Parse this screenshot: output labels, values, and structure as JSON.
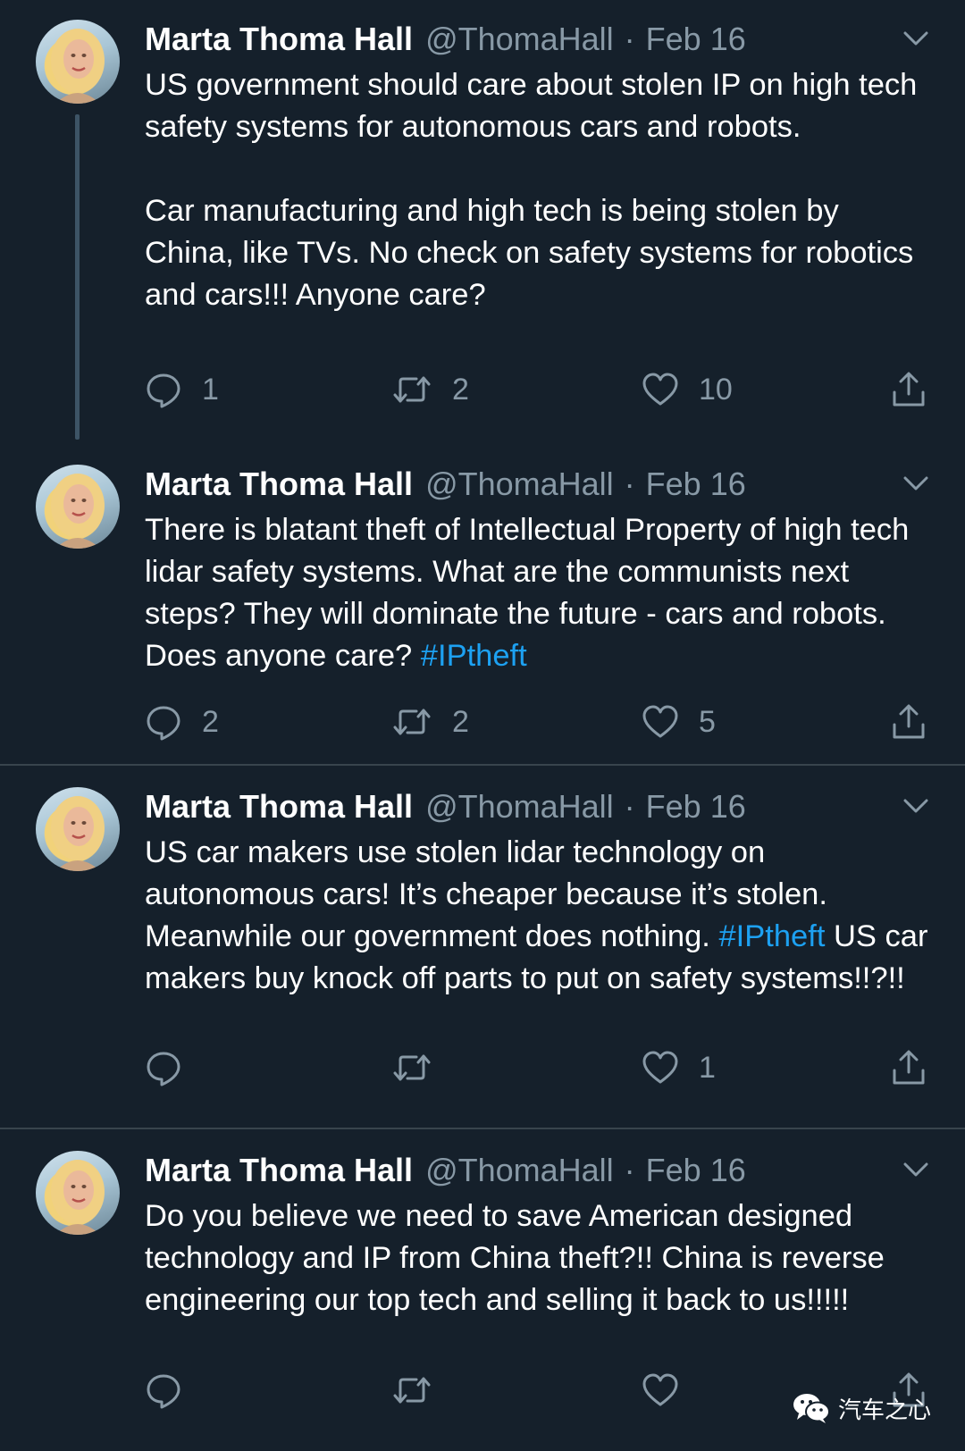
{
  "author": {
    "name": "Marta Thoma Hall",
    "handle": "@ThomaHall",
    "separator": "·"
  },
  "tweets": [
    {
      "date": "Feb 16",
      "paragraph1": "US government should care about stolen IP on high tech safety systems for autonomous cars and robots.",
      "paragraph2": "Car manufacturing and high tech is being stolen by China, like TVs. No check on safety systems for robotics and cars!!! Anyone care?",
      "replies": "1",
      "retweets": "2",
      "likes": "10"
    },
    {
      "date": "Feb 16",
      "text_before": "There is blatant theft of Intellectual Property of high tech lidar safety systems. What are the communists next steps? They will dominate the future - cars and robots. Does anyone care? ",
      "hashtag": "#IPtheft",
      "replies": "2",
      "retweets": "2",
      "likes": "5"
    },
    {
      "date": "Feb 16",
      "text_before": "US car makers use stolen lidar technology on autonomous cars! It’s cheaper because it’s stolen. Meanwhile our government does nothing. ",
      "hashtag": "#IPtheft",
      "text_after": " US car makers buy knock off parts to put on safety systems!!?!!",
      "replies": "",
      "retweets": "",
      "likes": "1"
    },
    {
      "date": "Feb 16",
      "text_before": "Do you believe we need to save American designed technology and IP from China theft?!! China is reverse engineering our top tech and selling it back to us!!!!!",
      "replies": "",
      "retweets": "",
      "likes": ""
    }
  ],
  "watermark": {
    "text": "汽车之心",
    "icon": "wechat-icon"
  },
  "icons": {
    "reply": "reply-icon",
    "retweet": "retweet-icon",
    "like": "like-icon",
    "share": "share-icon",
    "caret": "chevron-down-icon"
  },
  "colors": {
    "background": "#15202b",
    "secondary_text": "#8899a6",
    "hashtag": "#1da1f2",
    "divider": "#38444d"
  }
}
